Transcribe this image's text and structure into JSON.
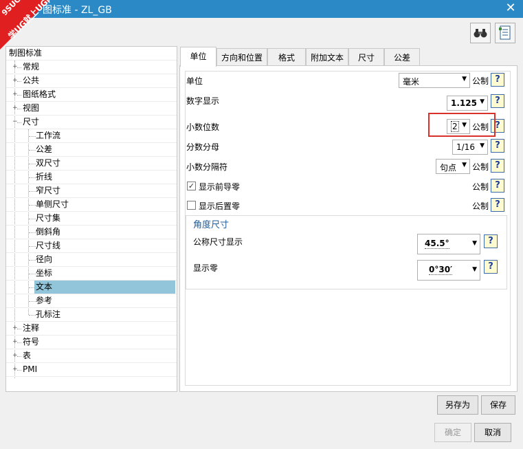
{
  "window": {
    "title": "图标准 - ZL_GB"
  },
  "watermark": {
    "line1": "9SUG",
    "line2": "学UG就上UG网"
  },
  "tree": {
    "root": "制图标准",
    "items": [
      {
        "label": "常规",
        "level": 1,
        "expander": "+"
      },
      {
        "label": "公共",
        "level": 1,
        "expander": "+"
      },
      {
        "label": "图纸格式",
        "level": 1,
        "expander": "+"
      },
      {
        "label": "视图",
        "level": 1,
        "expander": "+"
      },
      {
        "label": "尺寸",
        "level": 1,
        "expander": "−"
      },
      {
        "label": "工作流",
        "level": 2
      },
      {
        "label": "公差",
        "level": 2
      },
      {
        "label": "双尺寸",
        "level": 2
      },
      {
        "label": "折线",
        "level": 2
      },
      {
        "label": "窄尺寸",
        "level": 2
      },
      {
        "label": "单侧尺寸",
        "level": 2
      },
      {
        "label": "尺寸集",
        "level": 2
      },
      {
        "label": "倒斜角",
        "level": 2
      },
      {
        "label": "尺寸线",
        "level": 2
      },
      {
        "label": "径向",
        "level": 2
      },
      {
        "label": "坐标",
        "level": 2
      },
      {
        "label": "文本",
        "level": 2,
        "selected": true
      },
      {
        "label": "参考",
        "level": 2
      },
      {
        "label": "孔标注",
        "level": 2
      },
      {
        "label": "注释",
        "level": 1,
        "expander": "+"
      },
      {
        "label": "符号",
        "level": 1,
        "expander": "+"
      },
      {
        "label": "表",
        "level": 1,
        "expander": "+"
      },
      {
        "label": "PMI",
        "level": 1,
        "expander": "+"
      }
    ]
  },
  "tabs": [
    "单位",
    "方向和位置",
    "格式",
    "附加文本",
    "尺寸",
    "公差"
  ],
  "form": {
    "unit_label": "单位",
    "unit_value": "毫米",
    "unit_std": "公制",
    "num_display_label": "数字显示",
    "num_display_value": "1.125",
    "decimals_label": "小数位数",
    "decimals_value": "2",
    "decimals_std": "公制",
    "fraction_label": "分数分母",
    "fraction_value": "1/16",
    "dec_sep_label": "小数分隔符",
    "dec_sep_value": "句点",
    "dec_sep_std": "公制",
    "leading_zero_label": "显示前导零",
    "leading_zero_checked": "✓",
    "leading_zero_std": "公制",
    "trailing_zero_label": "显示后置零",
    "trailing_zero_std": "公制",
    "angle_group_title": "角度尺寸",
    "nominal_label": "公称尺寸显示",
    "nominal_value": "45.5°",
    "zero_label": "显示零",
    "zero_value": "0°30′",
    "help": "?",
    "arrow": "▼"
  },
  "buttons": {
    "save_as": "另存为",
    "save": "保存",
    "ok": "确定",
    "cancel": "取消"
  },
  "colors": {
    "titlebar": "#2b8ac6",
    "selection": "#92c5d9",
    "highlight": "#d9302c"
  }
}
